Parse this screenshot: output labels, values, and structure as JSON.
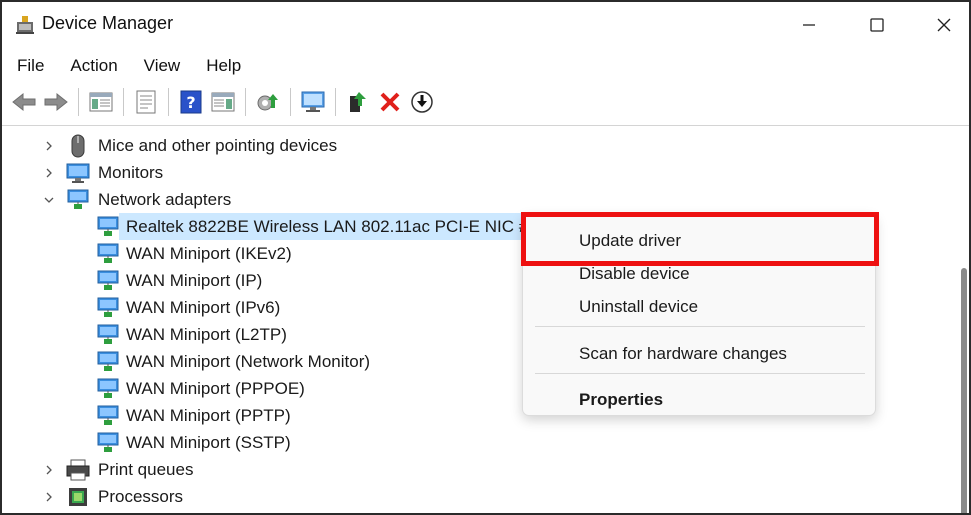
{
  "window": {
    "title": "Device Manager",
    "icon": "device-manager-icon"
  },
  "menu": [
    "File",
    "Action",
    "View",
    "Help"
  ],
  "toolbar": [
    {
      "name": "back-arrow-icon"
    },
    {
      "name": "forward-arrow-icon"
    },
    {
      "name": "show-hide-console-tree-icon"
    },
    {
      "name": "properties-icon"
    },
    {
      "name": "help-icon"
    },
    {
      "name": "action-pane-icon"
    },
    {
      "name": "update-driver-icon"
    },
    {
      "name": "scan-hardware-icon"
    },
    {
      "name": "enable-device-icon"
    },
    {
      "name": "uninstall-device-icon"
    },
    {
      "name": "disable-device-icon"
    }
  ],
  "tree": {
    "categories": [
      {
        "label": "Mice and other pointing devices",
        "expanded": false,
        "icon": "mouse-icon"
      },
      {
        "label": "Monitors",
        "expanded": false,
        "icon": "monitor-icon"
      },
      {
        "label": "Network adapters",
        "expanded": true,
        "icon": "network-adapter-icon"
      }
    ],
    "network_adapters": [
      "Realtek 8822BE Wireless LAN 802.11ac PCI-E NIC #2",
      "WAN Miniport (IKEv2)",
      "WAN Miniport (IP)",
      "WAN Miniport (IPv6)",
      "WAN Miniport (L2TP)",
      "WAN Miniport (Network Monitor)",
      "WAN Miniport (PPPOE)",
      "WAN Miniport (PPTP)",
      "WAN Miniport (SSTP)"
    ],
    "after": [
      {
        "label": "Print queues",
        "expanded": false,
        "icon": "printer-icon"
      },
      {
        "label": "Processors",
        "expanded": false,
        "icon": "processor-icon"
      }
    ],
    "selected_index": 0
  },
  "context_menu": {
    "items": [
      {
        "label": "Update driver",
        "highlighted": true
      },
      {
        "label": "Disable device"
      },
      {
        "label": "Uninstall device"
      },
      {
        "label": "Scan for hardware changes"
      },
      {
        "label": "Properties",
        "bold": true
      }
    ],
    "highlight_color": "#ee1111"
  },
  "colors": {
    "selection": "#cce8ff",
    "accent_green": "#2e9e3e",
    "accent_blue": "#1f6fd1",
    "delete_red": "#e0201b"
  }
}
